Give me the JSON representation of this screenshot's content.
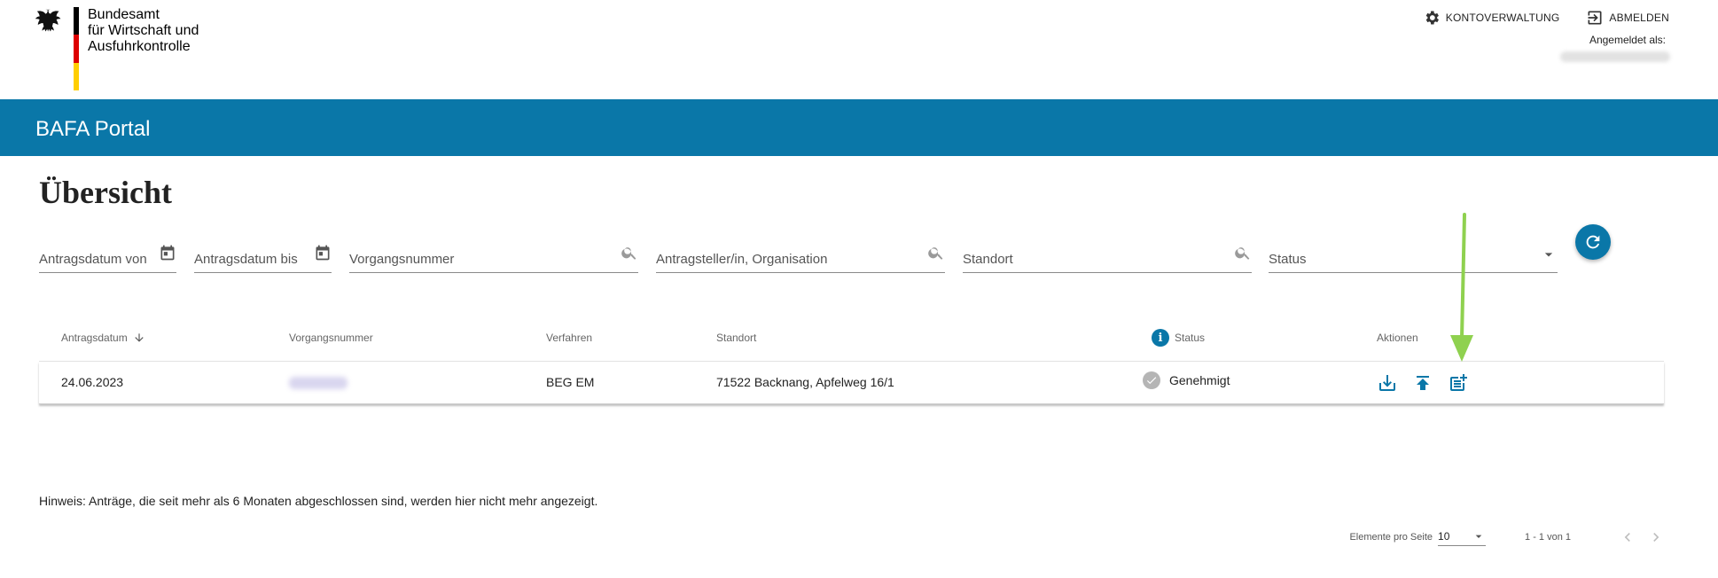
{
  "header": {
    "agency_line1": "Bundesamt",
    "agency_line2": "für Wirtschaft und",
    "agency_line3": "Ausfuhrkontrolle",
    "account_label": "KONTOVERWALTUNG",
    "logout_label": "ABMELDEN",
    "logged_in_label": "Angemeldet als:"
  },
  "portal": {
    "title": "BAFA Portal"
  },
  "page": {
    "title": "Übersicht"
  },
  "filters": {
    "date_from": "Antragsdatum von",
    "date_to": "Antragsdatum bis",
    "case_number": "Vorgangsnummer",
    "applicant": "Antragsteller/in, Organisation",
    "location": "Standort",
    "status": "Status"
  },
  "table": {
    "columns": {
      "date": "Antragsdatum",
      "case_number": "Vorgangsnummer",
      "procedure": "Verfahren",
      "location": "Standort",
      "status": "Status",
      "actions": "Aktionen"
    },
    "rows": [
      {
        "date": "24.06.2023",
        "procedure": "BEG EM",
        "location": "71522 Backnang, Apfelweg 16/1",
        "status": "Genehmigt"
      }
    ]
  },
  "footer": {
    "hint": "Hinweis: Anträge, die seit mehr als 6 Monaten abgeschlossen sind, werden hier nicht mehr angezeigt.",
    "page_size_label": "Elemente pro Seite",
    "page_size_value": "10",
    "range_label": "1 - 1 von 1"
  },
  "colors": {
    "brand": "#0a77a8",
    "annotation_arrow": "#8fd14f"
  },
  "icons": [
    "eagle-icon",
    "gear-icon",
    "logout-icon",
    "calendar-icon",
    "search-icon",
    "dropdown-icon",
    "refresh-icon",
    "sort-arrow-icon",
    "info-icon",
    "check-icon",
    "download-icon",
    "upload-icon",
    "add-document-icon",
    "chevron-left-icon",
    "chevron-right-icon"
  ]
}
